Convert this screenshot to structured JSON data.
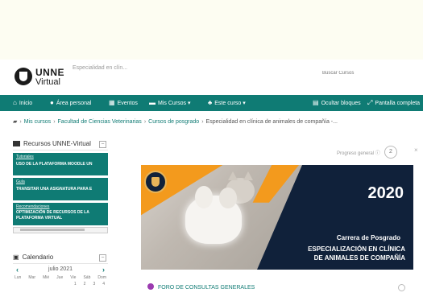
{
  "header": {
    "logo_unne": "UNNE",
    "logo_virtual": "Virtual",
    "site_subtitle": "Especialidad en clín...",
    "search_placeholder": "Buscar Cursos"
  },
  "nav": {
    "items": [
      {
        "label": "Inicio",
        "icon": "home-icon"
      },
      {
        "label": "Área personal",
        "icon": "dashboard-icon"
      },
      {
        "label": "Eventos",
        "icon": "calendar-icon"
      },
      {
        "label": "Mis Cursos ▾",
        "icon": "courses-icon"
      },
      {
        "label": "Este curso ▾",
        "icon": "sitemap-icon"
      },
      {
        "label": "Ocultar bloques",
        "icon": "blocks-icon"
      },
      {
        "label": "Pantalla completa",
        "icon": "fullscreen-icon"
      }
    ]
  },
  "breadcrumb": {
    "mis_cursos": "Mis cursos",
    "facultad": "Facultad de Ciencias Veterinarias",
    "posgrado": "Cursos de posgrado",
    "current": "Especialidad en clínica de animales de compañía -..."
  },
  "recursos": {
    "title": "Recursos UNNE-Virtual",
    "tiles": [
      {
        "category": "Tutoriales",
        "text": "USO DE LA PLATAFORMA MOODLE UN"
      },
      {
        "category": "Guía",
        "text": "TRANSITAR UNA ASIGNATURA PARA E"
      },
      {
        "category": "Recomendaciones",
        "text": "OPTIMIZACIÓN DE RECURSOS DE LA PLATAFORMA VIRTUAL"
      }
    ]
  },
  "calendar": {
    "title": "Calendario",
    "month": "julio 2021",
    "prev": "‹",
    "next": "›",
    "weekdays": [
      "Lun",
      "Mar",
      "Mié",
      "Jue",
      "Vie",
      "Sáb",
      "Dom"
    ],
    "first_row": [
      "1",
      "2",
      "3",
      "4"
    ]
  },
  "progress": {
    "label": "Progreso general",
    "value": "2"
  },
  "banner": {
    "year": "2020",
    "type": "Carrera de Posgrado",
    "line1": "ESPECIALIZACIÓN EN CLÍNICA",
    "line2": "DE ANIMALES DE COMPAÑÍA"
  },
  "course": {
    "forum_label": "FORO DE CONSULTAS GENERALES"
  },
  "colors": {
    "brand_teal": "#0f7b74",
    "banner_navy": "#10213a",
    "banner_orange": "#f39a1d",
    "forum_icon": "#9b3bb0"
  }
}
